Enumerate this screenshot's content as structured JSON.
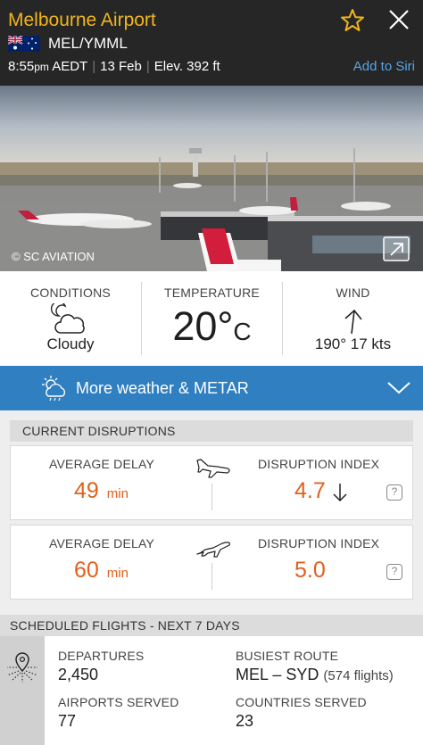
{
  "header": {
    "title": "Melbourne Airport",
    "codes": "MEL/YMML",
    "time": "8:55",
    "ampm": "pm",
    "timezone": "AEDT",
    "date": "13 Feb",
    "elevation": "Elev. 392 ft",
    "add_to_siri": "Add to Siri",
    "accent_color": "#f2b51c",
    "siri_color": "#58a5e8"
  },
  "photo": {
    "credit": "© SC AVIATION"
  },
  "weather": {
    "conditions_label": "CONDITIONS",
    "conditions_value": "Cloudy",
    "conditions_icon": "cloud-moon-icon",
    "temperature_label": "TEMPERATURE",
    "temperature_value": "20°",
    "temperature_unit": "C",
    "wind_label": "WIND",
    "wind_value": "190° 17 kts",
    "wind_icon": "wind-direction-arrow-icon"
  },
  "more_weather": {
    "label": "More weather & METAR",
    "bar_color": "#2f7fc1"
  },
  "disruptions": {
    "header": "CURRENT DISRUPTIONS",
    "value_color": "#e0601c",
    "arrivals": {
      "avg_delay_label": "AVERAGE DELAY",
      "avg_delay_value": "49",
      "avg_delay_unit": "min",
      "index_label": "DISRUPTION INDEX",
      "index_value": "4.7",
      "trend": "down"
    },
    "departures": {
      "avg_delay_label": "AVERAGE DELAY",
      "avg_delay_value": "60",
      "avg_delay_unit": "min",
      "index_label": "DISRUPTION INDEX",
      "index_value": "5.0"
    }
  },
  "scheduled": {
    "header": "SCHEDULED FLIGHTS - NEXT 7 DAYS",
    "departures_label": "DEPARTURES",
    "departures_value": "2,450",
    "busiest_route_label": "BUSIEST ROUTE",
    "busiest_route_value": "MEL – SYD",
    "busiest_route_note": "(574 flights)",
    "airports_served_label": "AIRPORTS SERVED",
    "airports_served_value": "77",
    "countries_served_label": "COUNTRIES SERVED",
    "countries_served_value": "23"
  }
}
